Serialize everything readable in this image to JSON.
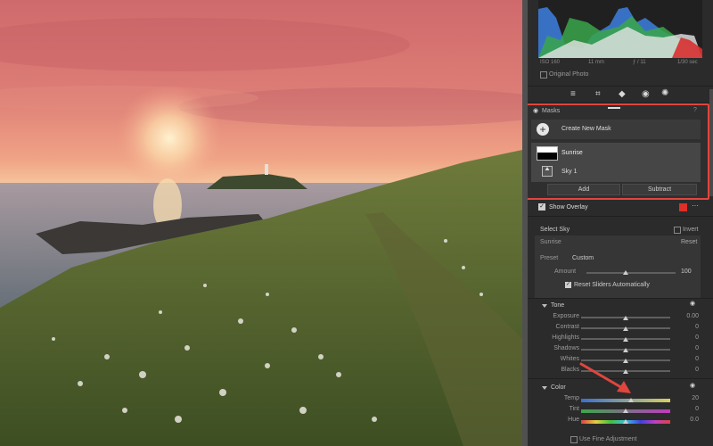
{
  "histogram": {
    "iso": "ISO 160",
    "focal": "11 mm",
    "aperture": "ƒ / 11",
    "shutter": "1/30 sec",
    "original_photo": "Original Photo"
  },
  "masks": {
    "title": "Masks",
    "create_new": "Create New Mask",
    "items": [
      {
        "label": "Sunrise"
      },
      {
        "label": "Sky 1"
      }
    ],
    "add_label": "Add",
    "subtract_label": "Subtract"
  },
  "overlay": {
    "label": "Show Overlay",
    "color": "#e02e2a"
  },
  "select_sky": {
    "label": "Select Sky",
    "invert": "Invert",
    "mask_name": "Sunrise",
    "reset": "Reset",
    "preset_label": "Preset",
    "preset_value": "Custom",
    "amount_label": "Amount",
    "amount_value": "100",
    "reset_sliders": "Reset Sliders Automatically"
  },
  "tone": {
    "title": "Tone",
    "sliders": [
      {
        "label": "Exposure",
        "value": "0.00",
        "pos": 0.5
      },
      {
        "label": "Contrast",
        "value": "0",
        "pos": 0.5
      },
      {
        "label": "Highlights",
        "value": "0",
        "pos": 0.5
      },
      {
        "label": "Shadows",
        "value": "0",
        "pos": 0.5
      },
      {
        "label": "Whites",
        "value": "0",
        "pos": 0.5
      },
      {
        "label": "Blacks",
        "value": "0",
        "pos": 0.5
      }
    ]
  },
  "color": {
    "title": "Color",
    "sliders": [
      {
        "label": "Temp",
        "value": "20",
        "pos": 0.56
      },
      {
        "label": "Tint",
        "value": "0",
        "pos": 0.5
      },
      {
        "label": "Hue",
        "value": "0.0",
        "pos": 0.5
      }
    ],
    "fine_adjust": "Use Fine Adjustment"
  },
  "accent": {
    "highlight_border": "#e0463e",
    "arrow": "#e0463e"
  }
}
